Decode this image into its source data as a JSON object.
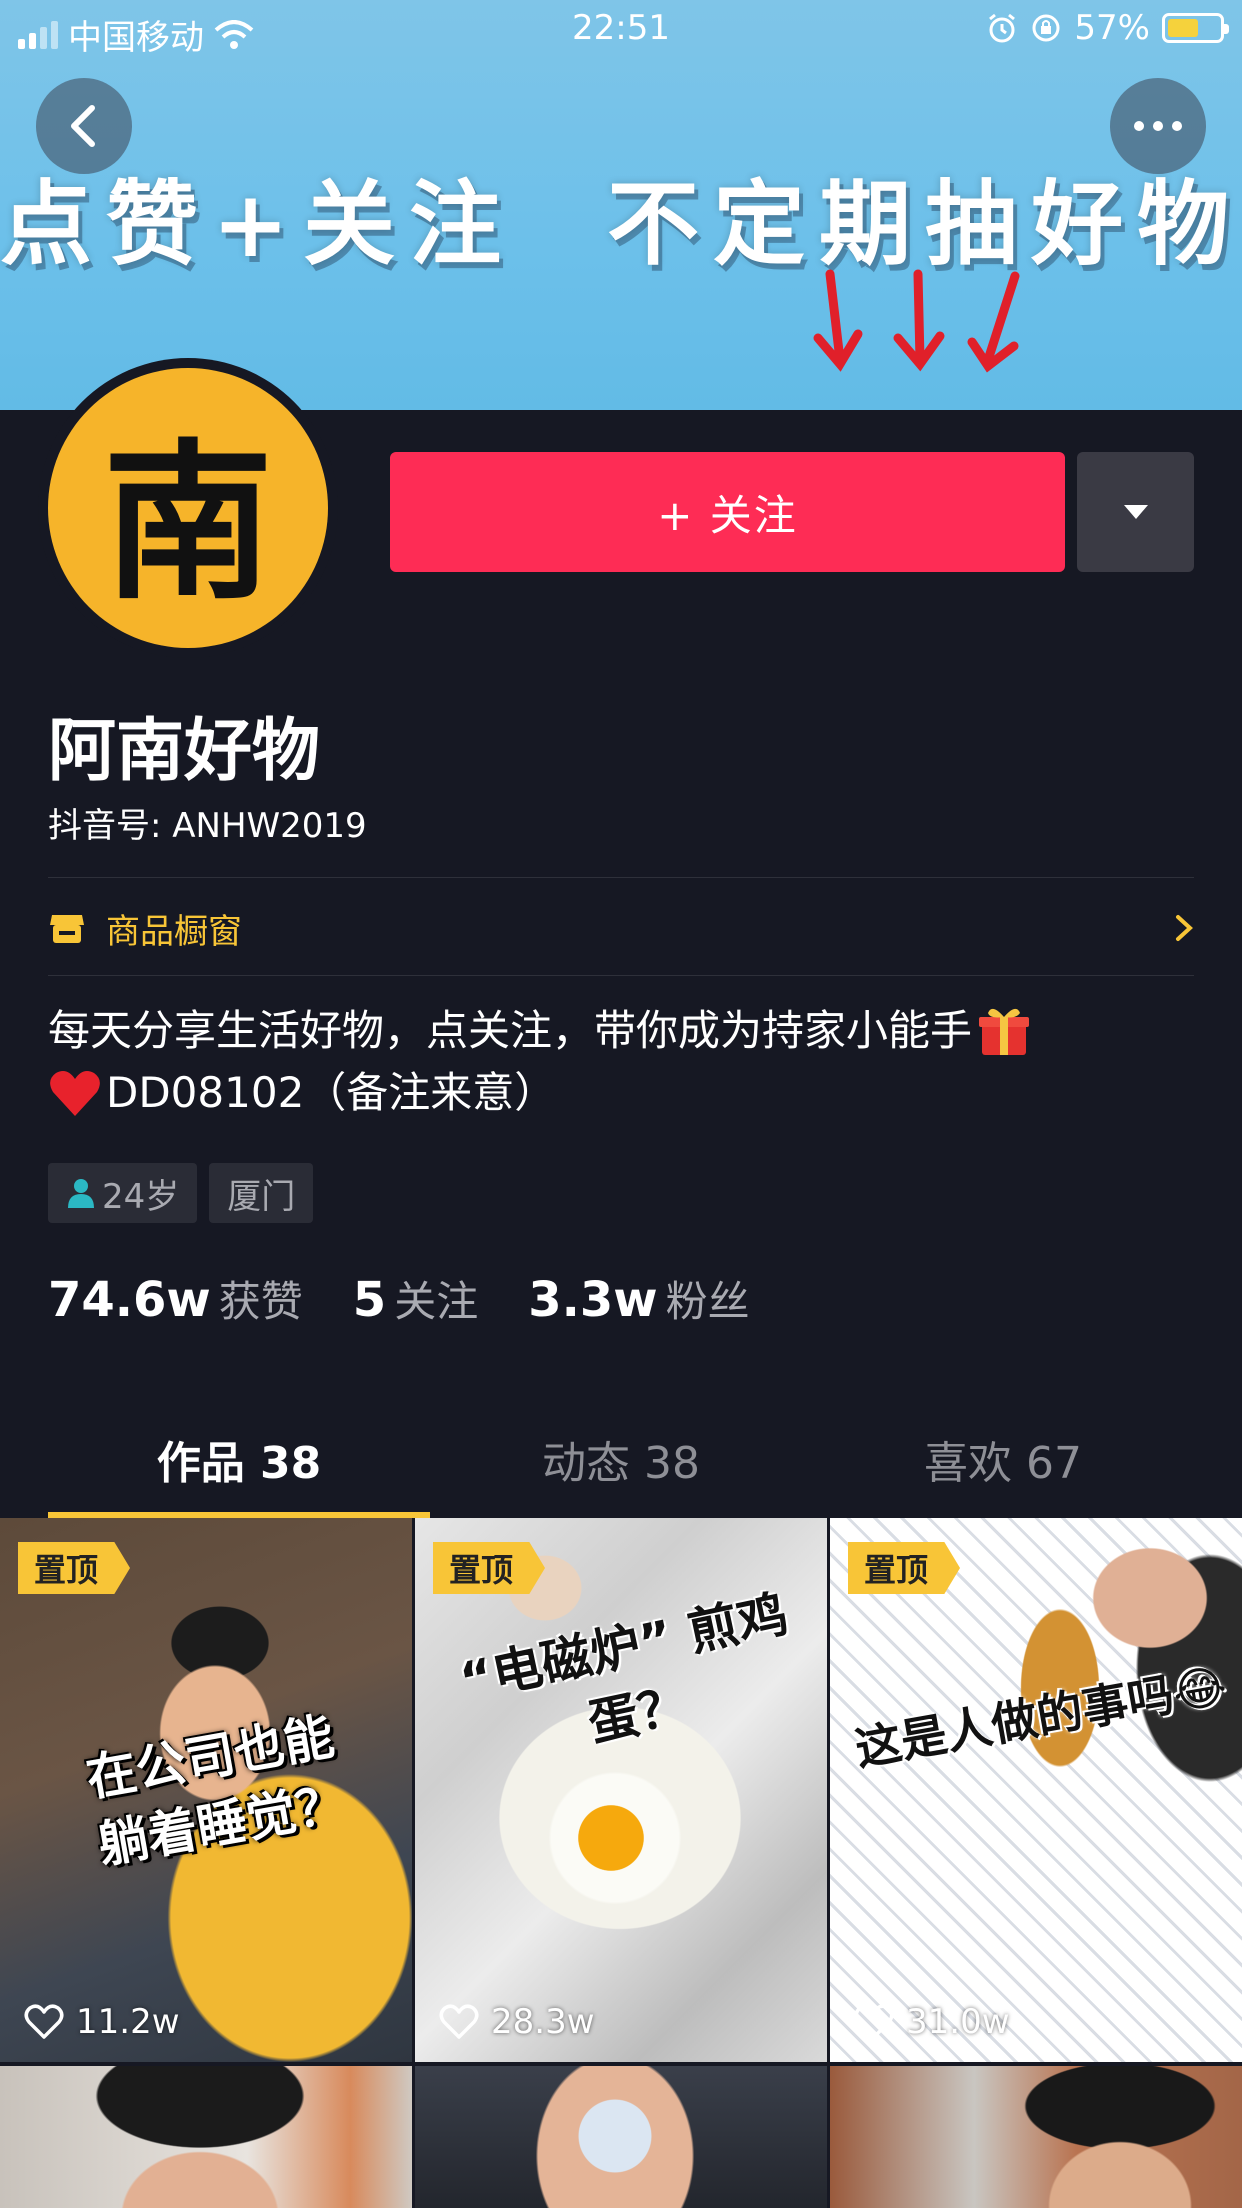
{
  "status_bar": {
    "carrier": "中国移动",
    "time": "22:51",
    "battery": "57%",
    "battery_level": 0.57
  },
  "banner": {
    "text": "点赞+关注  不定期抽好物",
    "background_color": "#6cc0ea"
  },
  "profile": {
    "avatar_char": "南",
    "follow_label": "+ 关注",
    "name": "阿南好物",
    "douyin_id": "抖音号: ANHW2019",
    "shop_label": "商品橱窗",
    "bio_line1": "每天分享生活好物，点关注，带你成为持家小能手",
    "bio_line2": "DD08102（备注来意）",
    "tags": {
      "age": "24岁",
      "city": "厦门"
    },
    "stats": {
      "likes_value": "74.6w",
      "likes_label": "获赞",
      "following_value": "5",
      "following_label": "关注",
      "fans_value": "3.3w",
      "fans_label": "粉丝"
    }
  },
  "tabs": [
    {
      "label": "作品 38",
      "active": true
    },
    {
      "label": "动态 38",
      "active": false
    },
    {
      "label": "喜欢 67",
      "active": false
    }
  ],
  "videos": [
    {
      "pin": "置顶",
      "caption": "在公司也能\n躺着睡觉？",
      "likes": "11.2w"
    },
    {
      "pin": "置顶",
      "caption": "“电磁炉” 煎鸡蛋？",
      "likes": "28.3w"
    },
    {
      "pin": "置顶",
      "caption": "这是人做的事吗😂",
      "likes": "31.0w"
    }
  ],
  "colors": {
    "background": "#161823",
    "accent_red": "#fe2c55",
    "accent_yellow": "#f8c537",
    "avatar_yellow": "#f6b42a"
  }
}
